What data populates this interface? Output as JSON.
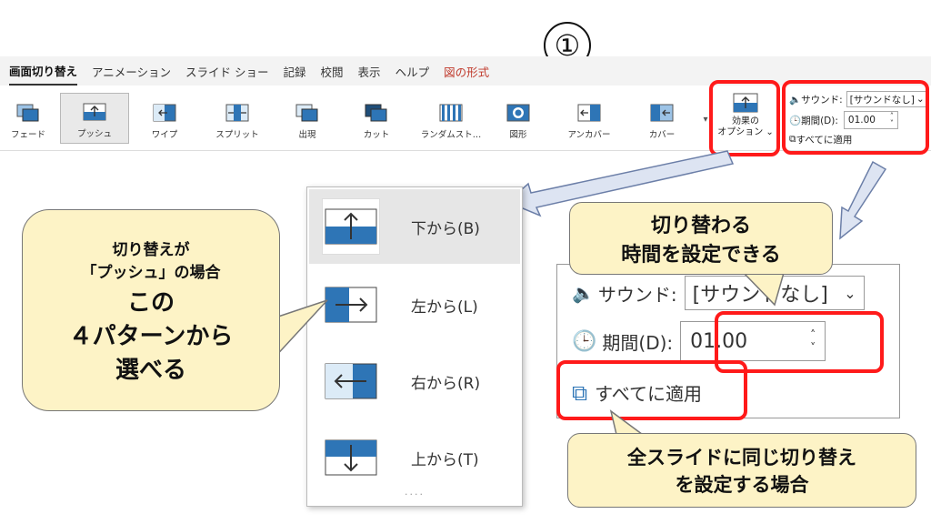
{
  "step_number": "①",
  "ribbon": {
    "tabs": [
      {
        "label": "画面切り替え"
      },
      {
        "label": "アニメーション"
      },
      {
        "label": "スライド ショー"
      },
      {
        "label": "記録"
      },
      {
        "label": "校閲"
      },
      {
        "label": "表示"
      },
      {
        "label": "ヘルプ"
      },
      {
        "label": "図の形式"
      }
    ],
    "gallery": [
      {
        "label": "フェード"
      },
      {
        "label": "プッシュ"
      },
      {
        "label": "ワイプ"
      },
      {
        "label": "スプリット"
      },
      {
        "label": "出現"
      },
      {
        "label": "カット"
      },
      {
        "label": "ランダムスト…"
      },
      {
        "label": "図形"
      },
      {
        "label": "アンカバー"
      },
      {
        "label": "カバー"
      }
    ],
    "effect_options": {
      "line1": "効果の",
      "line2": "オプション ⌄"
    },
    "sound_label": "サウンド:",
    "sound_value": "[サウンドなし]",
    "duration_label": "期間(D):",
    "duration_value": "01.00",
    "apply_all_label": "すべてに適用"
  },
  "dropdown": {
    "items": [
      {
        "label": "下から(B)"
      },
      {
        "label": "左から(L)"
      },
      {
        "label": "右から(R)"
      },
      {
        "label": "上から(T)"
      }
    ],
    "grip": "····"
  },
  "zoom_panel": {
    "sound_label": "サウンド:",
    "sound_value": "[サウンドなし]",
    "duration_label": "期間(D):",
    "duration_value": "01.00",
    "apply_all_label": "すべてに適用"
  },
  "callouts": {
    "left": {
      "line1": "切り替えが",
      "line2": "「プッシュ」の場合",
      "line3": "この",
      "line4": "４パターンから",
      "line5": "選べる"
    },
    "top_right": {
      "line1": "切り替わる",
      "line2": "時間を設定できる"
    },
    "bottom_right": {
      "line1": "全スライドに同じ切り替え",
      "line2": "を設定する場合"
    }
  },
  "colors": {
    "highlight_red": "#ff1a1a",
    "callout_fill": "#fdf3c6",
    "icon_blue": "#2e75b6"
  }
}
